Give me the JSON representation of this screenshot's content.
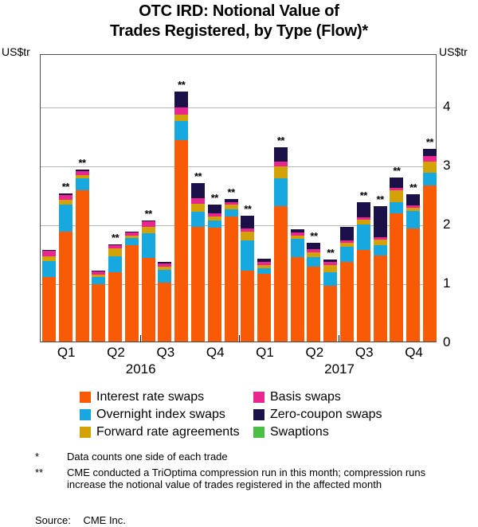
{
  "title": {
    "line1": "OTC IRD: Notional Value of",
    "line2": "Trades Registered, by Type (Flow)*"
  },
  "axis": {
    "unit_left": "US$tr",
    "unit_right": "US$tr",
    "yticks": [
      "0",
      "1",
      "2",
      "3",
      "4"
    ]
  },
  "xaxis": {
    "quarters": [
      "Q1",
      "Q2",
      "Q3",
      "Q4",
      "Q1",
      "Q2",
      "Q3",
      "Q4"
    ],
    "years": [
      "2016",
      "2017"
    ]
  },
  "legend": [
    {
      "label": "Interest rate swaps",
      "color": "#f95a05",
      "key": "interest_rate_swaps"
    },
    {
      "label": "Basis swaps",
      "color": "#e9268f",
      "key": "basis_swaps"
    },
    {
      "label": "Overnight index swaps",
      "color": "#18a8e0",
      "key": "overnight_index_swaps"
    },
    {
      "label": "Zero-coupon swaps",
      "color": "#1b1048",
      "key": "zero_coupon_swaps"
    },
    {
      "label": "Forward rate agreements",
      "color": "#d3a206",
      "key": "forward_rate_agreements"
    },
    {
      "label": "Swaptions",
      "color": "#49bf45",
      "key": "swaptions"
    }
  ],
  "notes": [
    {
      "mark": "*",
      "text": "Data counts one side of each trade"
    },
    {
      "mark": "**",
      "text": "CME conducted a TriOptima compression run in this month; compression runs increase the notional value of trades registered in the affected month"
    }
  ],
  "source": {
    "label": "Source:",
    "text": "CME Inc."
  },
  "star_marker": "**",
  "chart_data": {
    "type": "bar",
    "stacked": true,
    "title": "OTC IRD: Notional Value of Trades Registered, by Type (Flow)*",
    "xlabel": "",
    "ylabel": "US$tr",
    "ylim": [
      0,
      4.6
    ],
    "yticks": [
      0,
      1,
      2,
      3,
      4
    ],
    "grid": true,
    "legend_position": "below",
    "categories": [
      "2016-01",
      "2016-02",
      "2016-03",
      "2016-04",
      "2016-05",
      "2016-06",
      "2016-07",
      "2016-08",
      "2016-09",
      "2016-10",
      "2016-11",
      "2016-12",
      "2017-01",
      "2017-02",
      "2017-03",
      "2017-04",
      "2017-05",
      "2017-06",
      "2017-07",
      "2017-08",
      "2017-09",
      "2017-10",
      "2017-11",
      "2017-12"
    ],
    "quarter_groups": [
      {
        "label": "Q1",
        "year": "2016",
        "months": [
          0,
          1,
          2
        ]
      },
      {
        "label": "Q2",
        "year": "2016",
        "months": [
          3,
          4,
          5
        ]
      },
      {
        "label": "Q3",
        "year": "2016",
        "months": [
          6,
          7,
          8
        ]
      },
      {
        "label": "Q4",
        "year": "2016",
        "months": [
          9,
          10,
          11
        ]
      },
      {
        "label": "Q1",
        "year": "2017",
        "months": [
          12,
          13,
          14
        ]
      },
      {
        "label": "Q2",
        "year": "2017",
        "months": [
          15,
          16,
          17
        ]
      },
      {
        "label": "Q3",
        "year": "2017",
        "months": [
          18,
          19,
          20
        ]
      },
      {
        "label": "Q4",
        "year": "2017",
        "months": [
          21,
          22,
          23
        ]
      }
    ],
    "series": [
      {
        "name": "Interest rate swaps",
        "color": "#f95a05",
        "values": [
          1.1,
          1.87,
          2.57,
          0.97,
          1.18,
          1.63,
          1.42,
          1.0,
          3.42,
          1.95,
          1.93,
          2.12,
          1.2,
          1.15,
          2.3,
          1.43,
          1.27,
          0.95,
          1.35,
          1.56,
          1.46,
          2.17,
          1.92,
          2.65
        ]
      },
      {
        "name": "Overnight index swaps",
        "color": "#18a8e0",
        "values": [
          0.27,
          0.45,
          0.2,
          0.12,
          0.27,
          0.13,
          0.42,
          0.21,
          0.32,
          0.25,
          0.13,
          0.12,
          0.52,
          0.1,
          0.47,
          0.32,
          0.16,
          0.23,
          0.26,
          0.42,
          0.17,
          0.2,
          0.3,
          0.22
        ]
      },
      {
        "name": "Forward rate agreements",
        "color": "#d3a206",
        "values": [
          0.07,
          0.08,
          0.06,
          0.04,
          0.13,
          0.04,
          0.11,
          0.06,
          0.11,
          0.14,
          0.06,
          0.08,
          0.14,
          0.05,
          0.21,
          0.05,
          0.08,
          0.12,
          0.06,
          0.09,
          0.1,
          0.2,
          0.05,
          0.19
        ]
      },
      {
        "name": "Basis swaps",
        "color": "#e9268f",
        "values": [
          0.1,
          0.09,
          0.06,
          0.06,
          0.05,
          0.05,
          0.09,
          0.06,
          0.12,
          0.09,
          0.05,
          0.05,
          0.06,
          0.05,
          0.07,
          0.05,
          0.06,
          0.05,
          0.05,
          0.04,
          0.04,
          0.04,
          0.04,
          0.09
        ]
      },
      {
        "name": "Zero-coupon swaps",
        "color": "#1b1048",
        "values": [
          0.01,
          0.02,
          0.03,
          0.02,
          0.02,
          0.02,
          0.02,
          0.02,
          0.28,
          0.26,
          0.15,
          0.05,
          0.22,
          0.06,
          0.25,
          0.05,
          0.1,
          0.04,
          0.22,
          0.26,
          0.53,
          0.17,
          0.19,
          0.12
        ]
      },
      {
        "name": "Swaptions",
        "color": "#49bf45",
        "values": [
          0.0,
          0.0,
          0.0,
          0.0,
          0.0,
          0.0,
          0.0,
          0.0,
          0.0,
          0.0,
          0.0,
          0.0,
          0.0,
          0.0,
          0.0,
          0.0,
          0.0,
          0.0,
          0.0,
          0.0,
          0.0,
          0.0,
          0.0,
          0.0
        ]
      }
    ],
    "totals": [
      1.55,
      2.51,
      2.92,
      1.21,
      1.65,
      1.87,
      2.06,
      1.35,
      4.25,
      2.69,
      2.32,
      2.42,
      2.14,
      1.41,
      3.3,
      1.9,
      1.67,
      1.39,
      1.94,
      2.37,
      2.3,
      2.78,
      2.5,
      3.27
    ],
    "compression_months": [
      1,
      2,
      4,
      6,
      8,
      9,
      10,
      11,
      12,
      14,
      16,
      17,
      19,
      20,
      21,
      22,
      23
    ],
    "annotation": "** marks months in which CME conducted a TriOptima compression run"
  }
}
